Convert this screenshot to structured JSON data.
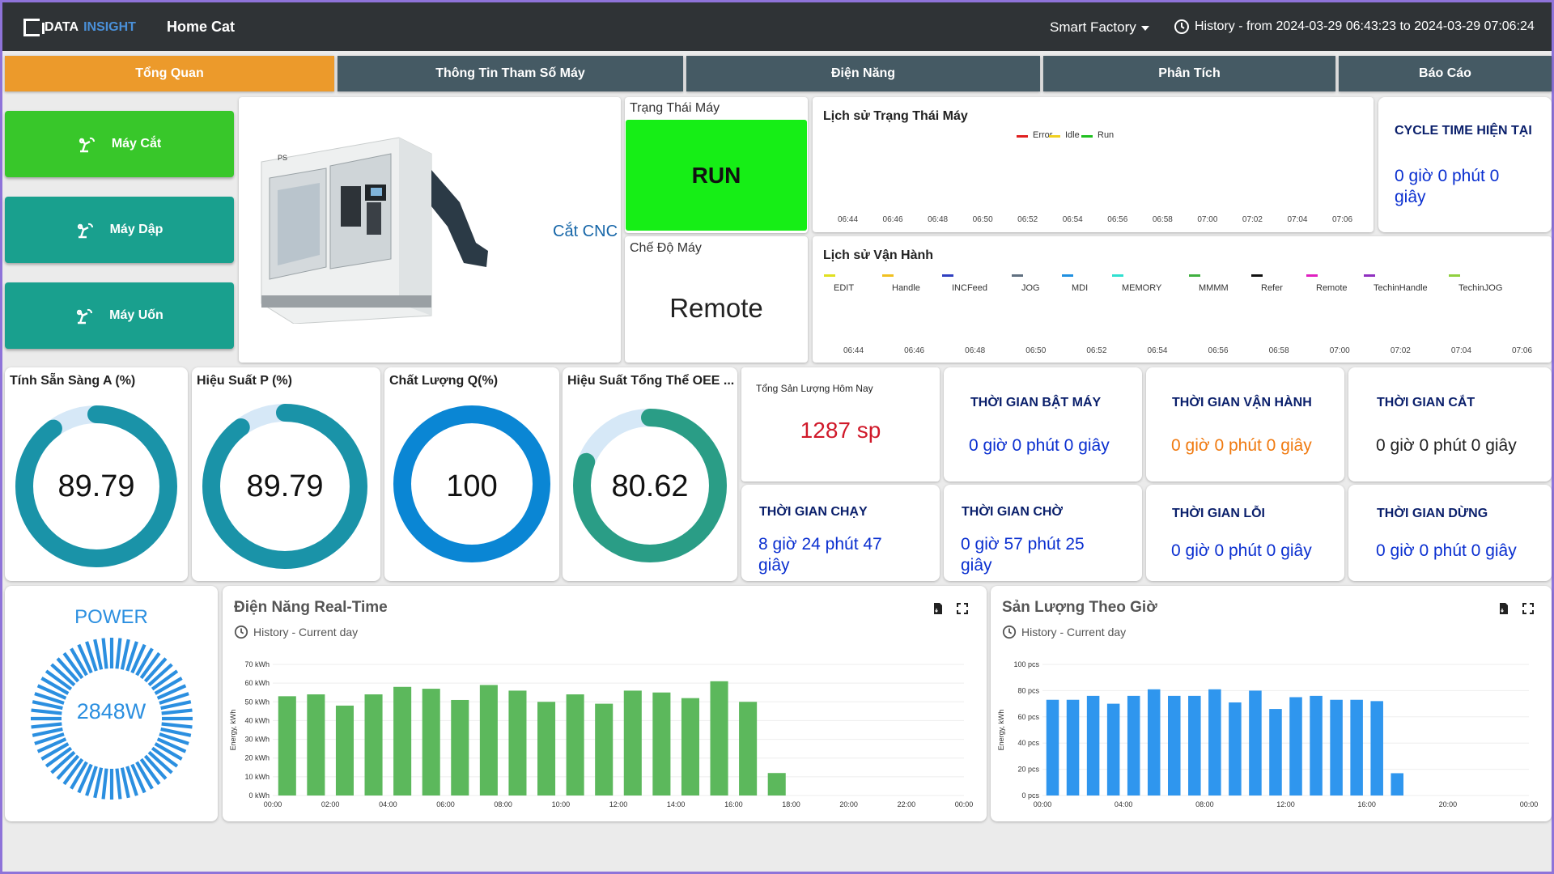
{
  "header": {
    "logo_data": "DATA",
    "logo_insight": "INSIGHT",
    "title": "Home Cat",
    "factory": "Smart Factory",
    "history": "History - from 2024-03-29 06:43:23 to 2024-03-29 07:06:24"
  },
  "tabs": [
    {
      "label": "Tổng Quan",
      "active": true
    },
    {
      "label": "Thông Tin Tham Số Máy",
      "active": false
    },
    {
      "label": "Điện Năng",
      "active": false
    },
    {
      "label": "Phân Tích",
      "active": false
    },
    {
      "label": "Báo Cáo",
      "active": false
    }
  ],
  "machines": [
    {
      "label": "Máy Cắt",
      "color": "#38c72a"
    },
    {
      "label": "Máy Dập",
      "color": "#19a08e"
    },
    {
      "label": "Máy Uốn",
      "color": "#19a08e"
    }
  ],
  "machine_card": {
    "caption": "Cắt CNC",
    "model": "PS"
  },
  "status": {
    "title": "Trạng Thái Máy",
    "value": "RUN",
    "color": "#16ee16"
  },
  "mode": {
    "title": "Chế Độ Máy",
    "value": "Remote"
  },
  "state_history": {
    "title": "Lịch sử Trạng Thái Máy",
    "legend": [
      {
        "name": "Error",
        "color": "#e02020"
      },
      {
        "name": "Idle",
        "color": "#f0d020"
      },
      {
        "name": "Run",
        "color": "#20c020"
      }
    ],
    "ticks": [
      "06:44",
      "06:46",
      "06:48",
      "06:50",
      "06:52",
      "06:54",
      "06:56",
      "06:58",
      "07:00",
      "07:02",
      "07:04",
      "07:06"
    ]
  },
  "cycle_time": {
    "title": "CYCLE TIME HIỆN TẠI",
    "value_line1": "0 giờ 0 phút 0",
    "value_line2": "giây"
  },
  "op_history": {
    "title": "Lịch sử Vận Hành",
    "legend": [
      {
        "name": "EDIT",
        "color": "#e0e020"
      },
      {
        "name": "Handle",
        "color": "#f0c020"
      },
      {
        "name": "INCFeed",
        "color": "#3040c0"
      },
      {
        "name": "JOG",
        "color": "#607080"
      },
      {
        "name": "MDI",
        "color": "#2090e0"
      },
      {
        "name": "MEMORY",
        "color": "#30e0d0"
      },
      {
        "name": "MMMM",
        "color": "#40b040"
      },
      {
        "name": "Refer",
        "color": "#111111"
      },
      {
        "name": "Remote",
        "color": "#e020c0"
      },
      {
        "name": "TechinHandle",
        "color": "#9030c0"
      },
      {
        "name": "TechinJOG",
        "color": "#90d040"
      }
    ],
    "ticks": [
      "06:44",
      "06:46",
      "06:48",
      "06:50",
      "06:52",
      "06:54",
      "06:56",
      "06:58",
      "07:00",
      "07:02",
      "07:04",
      "07:06"
    ]
  },
  "gauges": [
    {
      "title": "Tính Sẵn Sàng A (%)",
      "value": "89.79",
      "fraction": 0.8979,
      "color": "#1a93a8"
    },
    {
      "title": "Hiệu Suất P (%)",
      "value": "89.79",
      "fraction": 0.8979,
      "color": "#1a93a8"
    },
    {
      "title": "Chất Lượng Q(%)",
      "value": "100",
      "fraction": 1.0,
      "color": "#0a86d4"
    },
    {
      "title": "Hiệu Suất Tổng Thể OEE ...",
      "value": "80.62",
      "fraction": 0.8062,
      "color": "#2a9d86"
    }
  ],
  "output": {
    "title": "Tổng Sản Lượng Hôm Nay",
    "value": "1287 sp",
    "color": "#d0192a"
  },
  "kpis": [
    {
      "title": "THỜI GIAN BẬT MÁY",
      "value_line1": "0 giờ 0 phút 0 giây",
      "value_line2": "",
      "title_color": "#0a1f6b",
      "value_color": "#0a2fd0"
    },
    {
      "title": "THỜI GIAN VẬN HÀNH",
      "value_line1": "0 giờ 0 phút 0 giây",
      "value_line2": "",
      "title_color": "#0a1f6b",
      "value_color": "#f07a10"
    },
    {
      "title": "THỜI GIAN CẮT",
      "value_line1": "0 giờ 0 phút 0 giây",
      "value_line2": "",
      "title_color": "#0a1f6b",
      "value_color": "#222222"
    },
    {
      "title": "THỜI GIAN CHẠY",
      "value_line1": "8 giờ 24 phút 47",
      "value_line2": "giây",
      "title_color": "#0a1f6b",
      "value_color": "#0a2fd0"
    },
    {
      "title": "THỜI GIAN CHỜ",
      "value_line1": "0 giờ 57 phút 25",
      "value_line2": "giây",
      "title_color": "#0a1f6b",
      "value_color": "#0a2fd0"
    },
    {
      "title": "THỜI GIAN LỖI",
      "value_line1": "0 giờ 0 phút 0 giây",
      "value_line2": "",
      "title_color": "#0a1f6b",
      "value_color": "#0a2fd0"
    },
    {
      "title": "THỜI GIAN DỪNG",
      "value_line1": "0 giờ 0 phút 0 giây",
      "value_line2": "",
      "title_color": "#0a1f6b",
      "value_color": "#0a2fd0"
    }
  ],
  "power": {
    "title": "POWER",
    "value": "2848W",
    "color": "#2b8fe0"
  },
  "energy_chart": {
    "title": "Điện Năng Real-Time",
    "subtitle": "History - Current day"
  },
  "output_chart": {
    "title": "Sản Lượng Theo Giờ",
    "subtitle": "History - Current day"
  },
  "chart_data": [
    {
      "type": "bar",
      "title": "Điện Năng Real-Time",
      "ylabel": "Energy, kWh",
      "ylim": [
        0,
        70
      ],
      "yticks": [
        "0 kWh",
        "10 kWh",
        "20 kWh",
        "30 kWh",
        "40 kWh",
        "50 kWh",
        "60 kWh",
        "70 kWh"
      ],
      "xticks": [
        "00:00",
        "02:00",
        "04:00",
        "06:00",
        "08:00",
        "10:00",
        "12:00",
        "14:00",
        "16:00",
        "18:00",
        "20:00",
        "22:00",
        "00:00"
      ],
      "color": "#5cb85c",
      "values": [
        53,
        54,
        48,
        54,
        58,
        57,
        51,
        59,
        56,
        50,
        54,
        49,
        56,
        55,
        52,
        61,
        50,
        12
      ]
    },
    {
      "type": "bar",
      "title": "Sản Lượng Theo Giờ",
      "ylabel": "Energy, kWh",
      "ylim": [
        0,
        100
      ],
      "yticks": [
        "0 pcs",
        "20 pcs",
        "40 pcs",
        "60 pcs",
        "80 pcs",
        "100 pcs"
      ],
      "xticks": [
        "00:00",
        "04:00",
        "08:00",
        "12:00",
        "16:00",
        "20:00",
        "00:00"
      ],
      "color": "#2f96ee",
      "values": [
        73,
        73,
        76,
        70,
        76,
        81,
        76,
        76,
        81,
        71,
        80,
        66,
        75,
        76,
        73,
        73,
        72,
        17
      ]
    }
  ]
}
